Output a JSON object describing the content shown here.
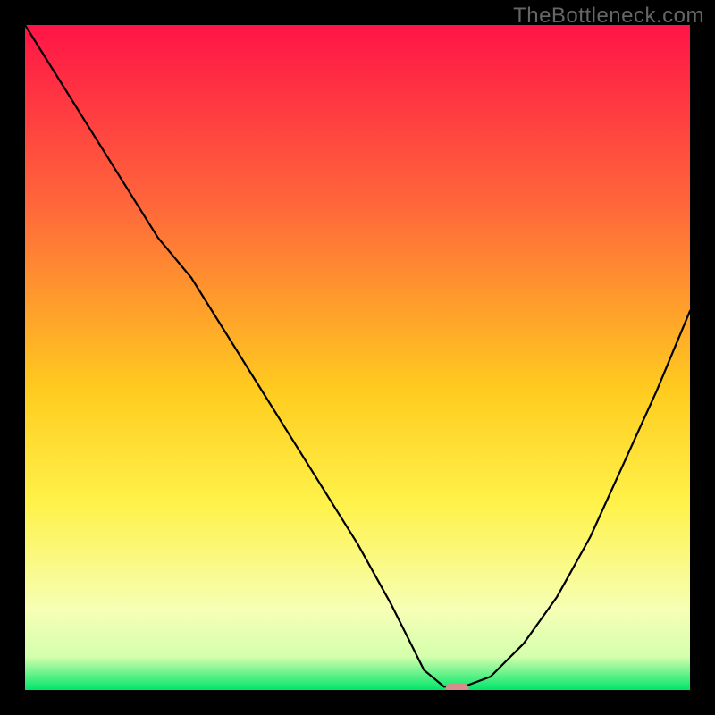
{
  "watermark": "TheBottleneck.com",
  "chart_data": {
    "type": "line",
    "title": "",
    "xlabel": "",
    "ylabel": "",
    "xlim": [
      0,
      100
    ],
    "ylim": [
      0,
      100
    ],
    "grid": false,
    "legend": false,
    "x": [
      0,
      5,
      10,
      15,
      20,
      25,
      30,
      35,
      40,
      45,
      50,
      55,
      58,
      60,
      63,
      66,
      70,
      75,
      80,
      85,
      90,
      95,
      100
    ],
    "values": [
      100,
      92,
      84,
      76,
      68,
      62,
      54,
      46,
      38,
      30,
      22,
      13,
      7,
      3,
      0.5,
      0.5,
      2,
      7,
      14,
      23,
      34,
      45,
      57
    ],
    "marker": {
      "x": 65,
      "y": 0.2,
      "color": "#d88c8c",
      "shape": "pill"
    },
    "background_gradient": {
      "top": "#ff1447",
      "mid1": "#ff6a3a",
      "mid2": "#ffcc1f",
      "mid3": "#fff24a",
      "mid4": "#f6ffb5",
      "bottom_band_top": "#d4ffad",
      "bottom": "#00e66a"
    }
  }
}
